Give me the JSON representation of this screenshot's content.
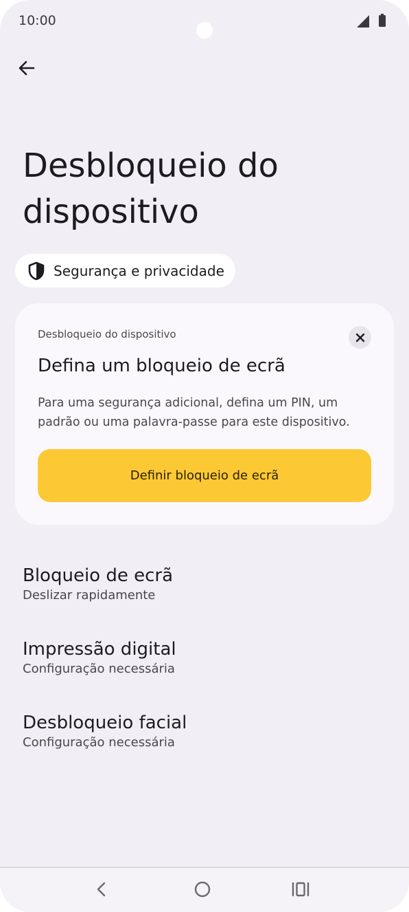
{
  "status": {
    "time": "10:00"
  },
  "page": {
    "title": "Desbloqueio do dispositivo"
  },
  "chip": {
    "label": "Segurança e privacidade",
    "icon": "shield-icon"
  },
  "card": {
    "caption": "Desbloqueio do dispositivo",
    "title": "Defina um bloqueio de ecrã",
    "text": "Para uma segurança adicional, defina um PIN, um padrão ou uma palavra-passe para este dispositivo.",
    "button": "Definir bloqueio de ecrã"
  },
  "settings": [
    {
      "title": "Bloqueio de ecrã",
      "subtitle": "Deslizar rapidamente"
    },
    {
      "title": "Impressão digital",
      "subtitle": "Configuração necessária"
    },
    {
      "title": "Desbloqueio facial",
      "subtitle": "Configuração necessária"
    }
  ],
  "colors": {
    "background": "#f1eef5",
    "card": "#faf8fd",
    "accent": "#fcc934"
  }
}
